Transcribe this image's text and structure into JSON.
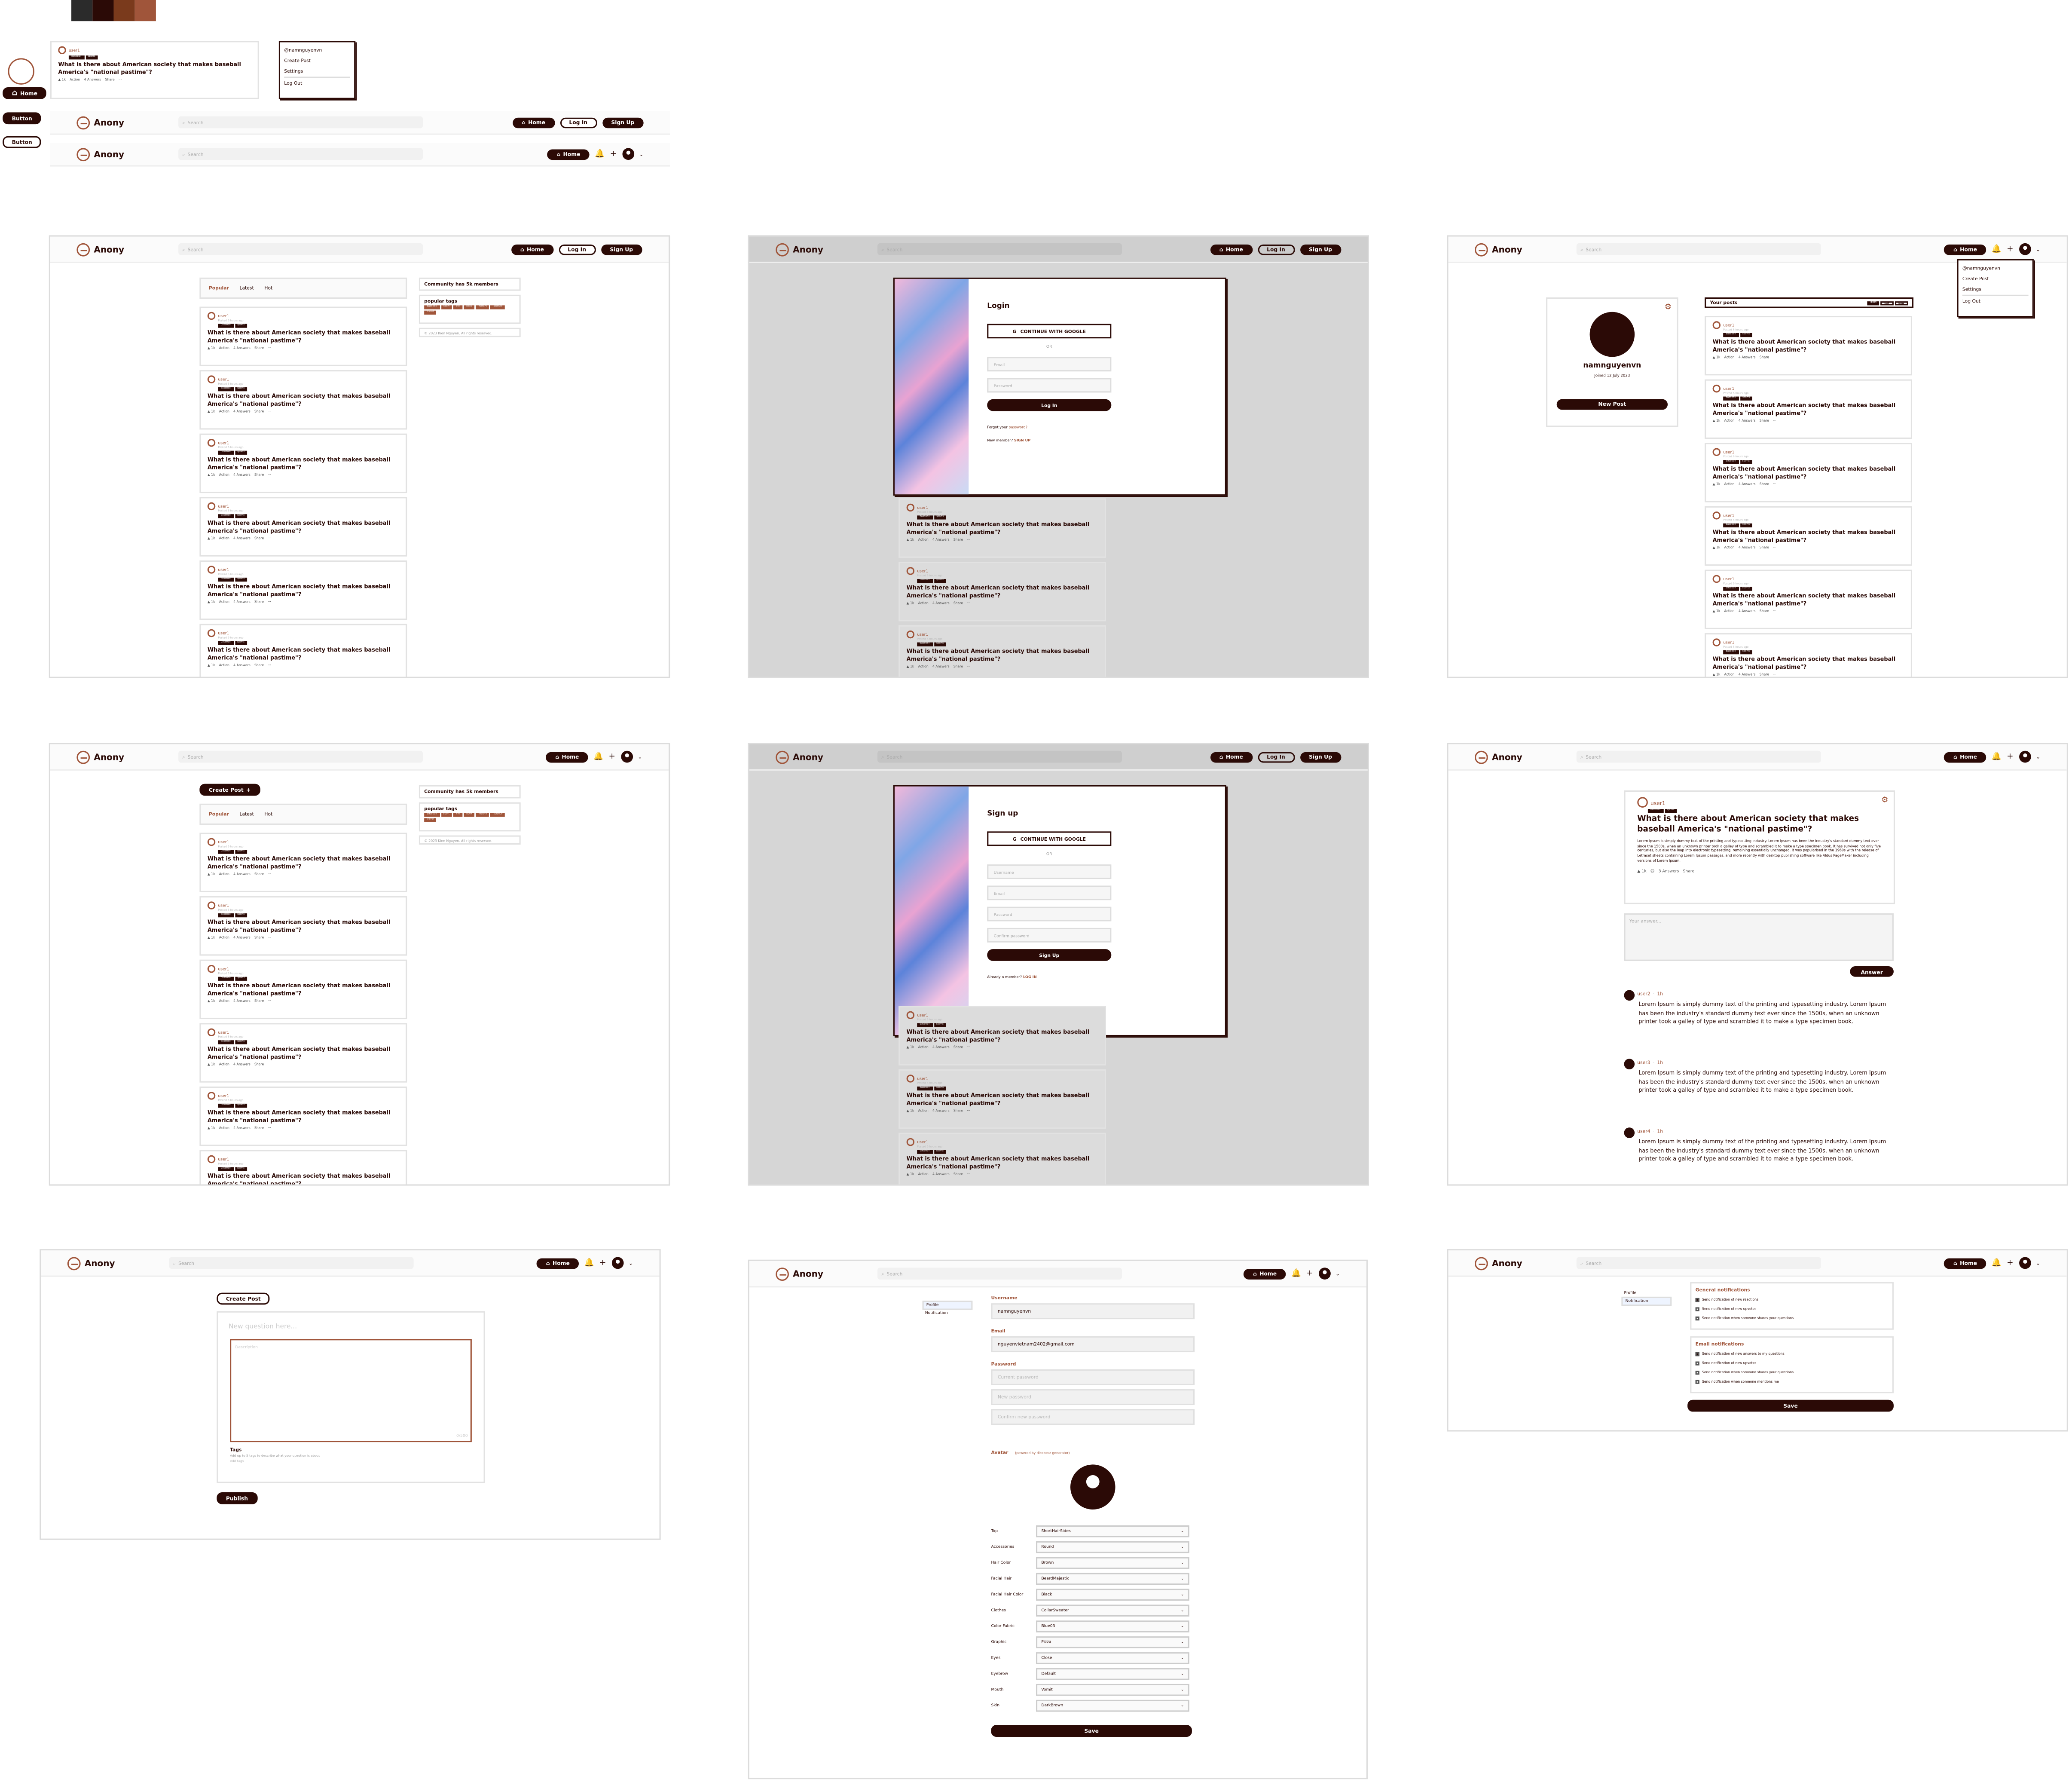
{
  "app": {
    "name": "Anony"
  },
  "palette": {
    "colors": [
      "#2b2b2b",
      "#2b0a06",
      "#7a3a1c",
      "#a0553a"
    ]
  },
  "nav": {
    "search_placeholder": "Search",
    "home": "Home",
    "login": "Log In",
    "signup": "Sign Up"
  },
  "components": {
    "home_button": "Home",
    "button_a": "Button",
    "button_b": "Button"
  },
  "post": {
    "user": "user1",
    "subtitle": "Posted 6 hours ago",
    "tags": [
      "baseball",
      "sports"
    ],
    "title": "What is there about American society that makes baseball America's \"national pastime\"?",
    "likes": "1k",
    "actions": {
      "reactions": "Action",
      "answers": "4 Answers",
      "share": "Share",
      "more": "···"
    }
  },
  "user_menu": {
    "username": "@namnguyenvn",
    "create_post": "Create Post",
    "settings": "Settings",
    "logout": "Log Out"
  },
  "feed": {
    "tabs": [
      "Popular",
      "Latest",
      "Hot"
    ],
    "community": "Community has 5k members",
    "popular_tags_label": "popular tags",
    "popular_tags": [
      "baseball",
      "sport",
      "life",
      "book",
      "history",
      "science",
      "travel"
    ],
    "footer": "© 2023 Kien Nguyen. All rights reserved.",
    "create_post_btn": "Create Post"
  },
  "login": {
    "title": "Login",
    "google": "CONTINUE WITH GOOGLE",
    "or": "OR",
    "email_ph": "Email",
    "password_ph": "Password",
    "submit": "Log In",
    "forgot_prefix": "Forgot your ",
    "forgot_link": "password?",
    "new_member": "New member? ",
    "signup_link": "SIGN UP"
  },
  "signup": {
    "title": "Sign up",
    "google": "CONTINUE WITH GOOGLE",
    "or": "OR",
    "username_ph": "Username",
    "email_ph": "Email",
    "password_ph": "Password",
    "confirm_ph": "Confirm password",
    "submit": "Sign Up",
    "already": "Already a member? ",
    "login_link": "LOG IN"
  },
  "profile": {
    "username": "namnguyenvn",
    "joined": "Joined 12 July 2023",
    "new_post": "New Post",
    "your_posts": "Your posts",
    "filters": [
      "Best",
      "Hot",
      "New"
    ]
  },
  "detail": {
    "user": "user1",
    "title": "What is there about American society that makes baseball America's \"national pastime\"?",
    "body": "Lorem Ipsum is simply dummy text of the printing and typesetting industry. Lorem Ipsum has been the industry's standard dummy text ever since the 1500s, when an unknown printer took a galley of type and scrambled it to make a type specimen book. It has survived not only five centuries, but also the leap into electronic typesetting, remaining essentially unchanged. It was popularised in the 1960s with the release of Letraset sheets containing Lorem Ipsum passages, and more recently with desktop publishing software like Aldus PageMaker including versions of Lorem Ipsum.",
    "answers": "3 Answers",
    "share": "Share",
    "answer_ph": "Your answer...",
    "answer_btn": "Answer",
    "comments": [
      {
        "user": "user2",
        "time": "1h",
        "text": "Lorem Ipsum is simply dummy text of the printing and typesetting industry. Lorem Ipsum has been the industry's standard dummy text ever since the 1500s, when an unknown printer took a galley of type and scrambled it to make a type specimen book."
      },
      {
        "user": "user3",
        "time": "1h",
        "text": "Lorem Ipsum is simply dummy text of the printing and typesetting industry. Lorem Ipsum has been the industry's standard dummy text ever since the 1500s, when an unknown printer took a galley of type and scrambled it to make a type specimen book."
      },
      {
        "user": "user4",
        "time": "1h",
        "text": "Lorem Ipsum is simply dummy text of the printing and typesetting industry. Lorem Ipsum has been the industry's standard dummy text ever since the 1500s, when an unknown printer took a galley of type and scrambled it to make a type specimen book."
      }
    ]
  },
  "create": {
    "title": "Create Post",
    "question_ph": "New question here...",
    "desc_ph": "Description",
    "counter": "0/500",
    "tags_label": "Tags",
    "tags_help": "Add up to 5 tags to describe what your question is about",
    "tags_ph": "Add tags",
    "publish": "Publish"
  },
  "settings": {
    "menu": [
      "Profile",
      "Notification"
    ],
    "username_label": "Username",
    "username": "namnguyenvn",
    "email_label": "Email",
    "email": "nguyenvietnam2402@gmail.com",
    "password_label": "Password",
    "password_ph": [
      "Current password",
      "New password",
      "Confirm new password"
    ],
    "avatar_label": "Avatar",
    "avatar_note": "(powered by dicebear generator)",
    "avatar_options": [
      {
        "label": "Top",
        "value": "ShortHairSides"
      },
      {
        "label": "Accessories",
        "value": "Round"
      },
      {
        "label": "Hair Color",
        "value": "Brown"
      },
      {
        "label": "Facial Hair",
        "value": "BeardMajestic"
      },
      {
        "label": "Facial Hair Color",
        "value": "Black"
      },
      {
        "label": "Clothes",
        "value": "CollarSweater"
      },
      {
        "label": "Color Fabric",
        "value": "Blue03"
      },
      {
        "label": "Graphic",
        "value": "Pizza"
      },
      {
        "label": "Eyes",
        "value": "Close"
      },
      {
        "label": "Eyebrow",
        "value": "Default"
      },
      {
        "label": "Mouth",
        "value": "Vomit"
      },
      {
        "label": "Skin",
        "value": "DarkBrown"
      }
    ],
    "save": "Save"
  },
  "notifications": {
    "general_title": "General notifications",
    "general": [
      {
        "text": "Send notification of new reactions",
        "checked": true
      },
      {
        "text": "Send notification of new upvotes",
        "checked": false
      },
      {
        "text": "Send notification when someone shares your questions",
        "checked": false
      }
    ],
    "email_title": "Email notifications",
    "email": [
      {
        "text": "Send notification of new answers to my questions",
        "checked": true
      },
      {
        "text": "Send notification of new upvotes",
        "checked": false
      },
      {
        "text": "Send notification when someone shares your questions",
        "checked": false
      },
      {
        "text": "Send notification when someone mentions me",
        "checked": false
      }
    ],
    "save": "Save"
  }
}
